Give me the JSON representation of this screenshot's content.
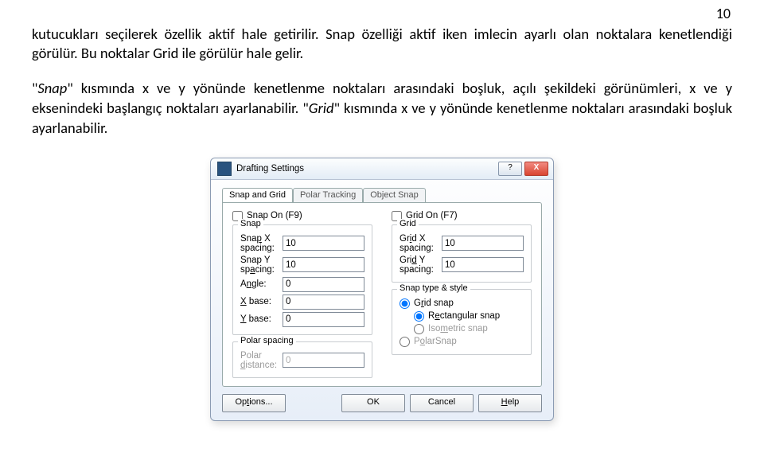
{
  "page": {
    "number": "10",
    "p1a": "kutucukları seçilerek özellik aktif hale getirilir. Snap özelliği aktif iken imlecin ayarlı olan noktalara kenetlendiği görülür. Bu noktalar Grid ile görülür hale gelir.",
    "p2_pre": "\"",
    "p2_em1": "Snap",
    "p2_mid": "\" kısmında x ve y yönünde kenetlenme noktaları arasındaki boşluk, açılı şekildeki görünümleri, x ve y eksenindeki başlangıç noktaları ayarlanabilir. \"",
    "p2_em2": "Grid",
    "p2_end": "\" kısmında x ve y yönünde kenetlenme noktaları arasındaki boşluk ayarlanabilir."
  },
  "dlg": {
    "title": "Drafting Settings",
    "help_glyph": "?",
    "close_glyph": "X",
    "tabs": {
      "snapgrid": "Snap and Grid",
      "polar": "Polar Tracking",
      "osnap": "Object Snap"
    },
    "snap_on": "Snap On (F9)",
    "grid_on": "Grid On (F7)",
    "snap_leg": "Snap",
    "grid_leg": "Grid",
    "snapx_lbl": "Snap X spacing:",
    "snapx": "10",
    "snapy_lbl": "Snap Y spacing:",
    "snapy": "10",
    "angle_lbl": "Angle:",
    "angle": "0",
    "xbase_lbl": "X base:",
    "xbase": "0",
    "ybase_lbl": "Y base:",
    "ybase": "0",
    "gridx_lbl": "Grid X spacing:",
    "gridx": "10",
    "gridy_lbl": "Grid Y spacing:",
    "gridy": "10",
    "style_leg": "Snap type & style",
    "gridsnap": "Grid snap",
    "rect": "Rectangular snap",
    "iso": "Isometric snap",
    "polarsnap": "PolarSnap",
    "pspacing_leg": "Polar spacing",
    "pdist_lbl": "Polar distance:",
    "pdist": "0",
    "options": "Options...",
    "ok": "OK",
    "cancel": "Cancel",
    "helpbtn": "Help"
  }
}
